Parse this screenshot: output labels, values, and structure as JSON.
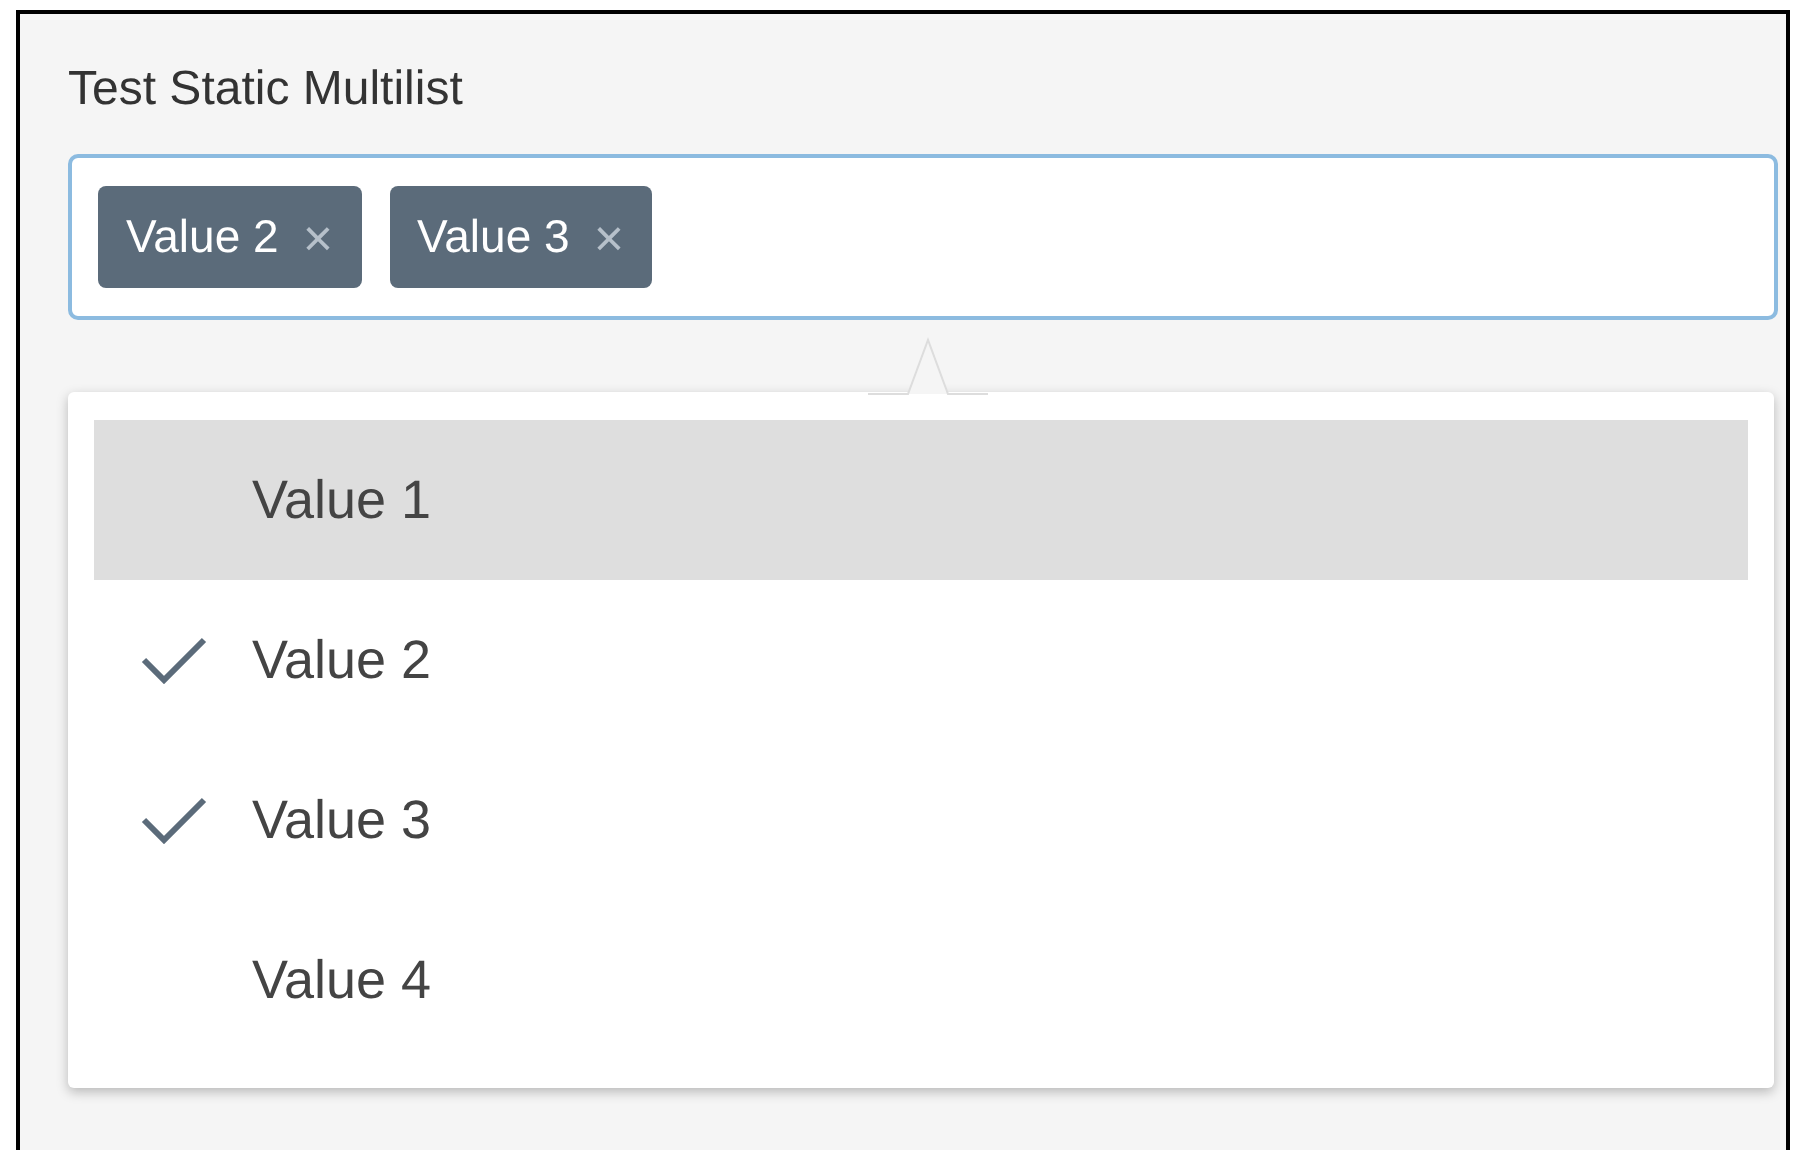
{
  "field": {
    "label": "Test Static Multilist",
    "chips": [
      {
        "label": "Value 2",
        "remove": "×"
      },
      {
        "label": "Value 3",
        "remove": "×"
      }
    ]
  },
  "dropdown": {
    "items": [
      {
        "label": "Value 1",
        "selected": false,
        "highlighted": true
      },
      {
        "label": "Value 2",
        "selected": true,
        "highlighted": false
      },
      {
        "label": "Value 3",
        "selected": true,
        "highlighted": false
      },
      {
        "label": "Value 4",
        "selected": false,
        "highlighted": false
      }
    ]
  }
}
